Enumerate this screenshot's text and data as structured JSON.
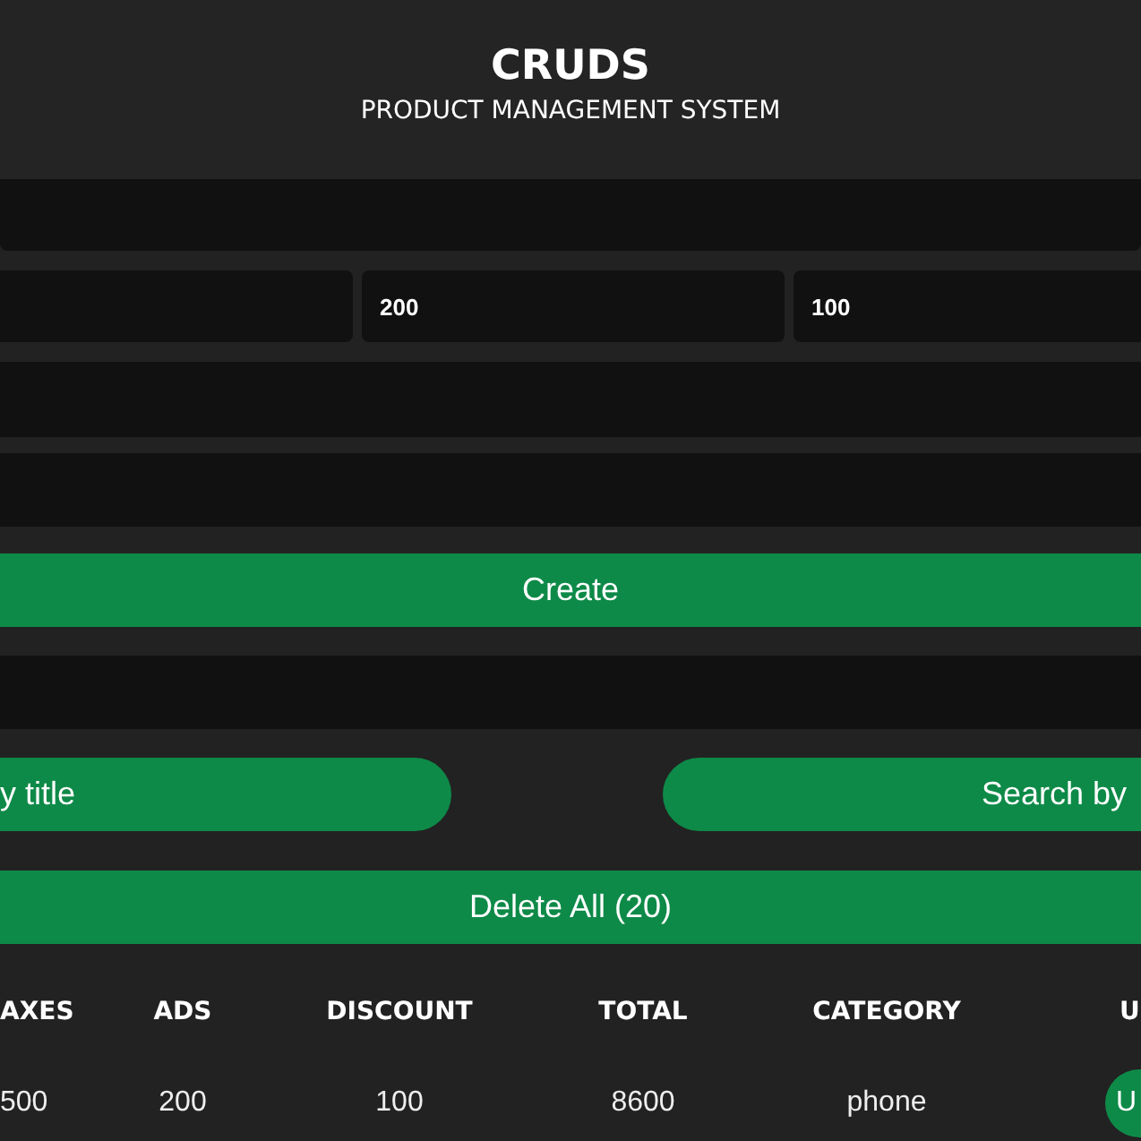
{
  "header": {
    "title": "CRUDS",
    "subtitle": "PRODUCT MANAGEMENT SYSTEM"
  },
  "price_row_values": [
    "200",
    "100"
  ],
  "create_button": "Create",
  "search_buttons": [
    "y title",
    "Search by"
  ],
  "delete_all_button": "Delete All (20)",
  "table": {
    "columns": [
      "AXES",
      "ADS",
      "DISCOUNT",
      "TOTAL",
      "CATEGORY",
      "U"
    ],
    "rows": [
      {
        "cells": [
          "500",
          "200",
          "100",
          "8600",
          "phone"
        ],
        "update_button": "U"
      }
    ]
  }
}
